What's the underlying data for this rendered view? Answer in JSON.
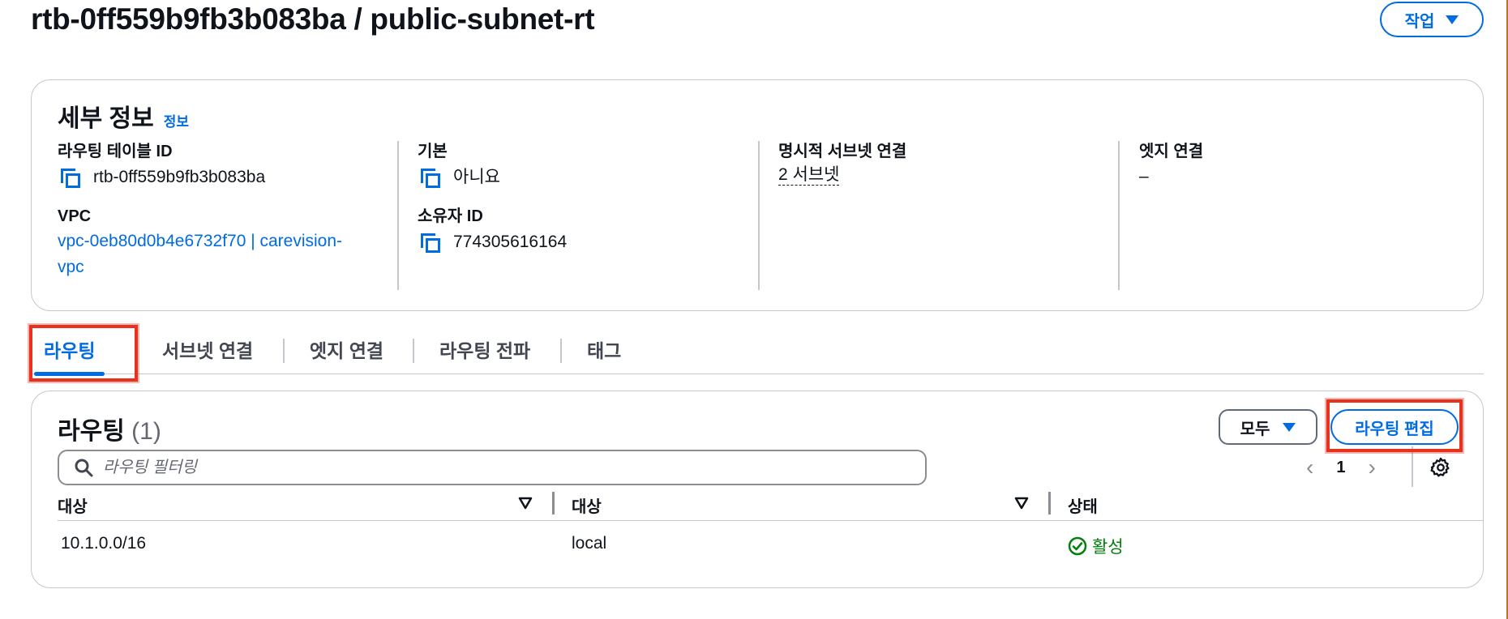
{
  "header": {
    "title": "rtb-0ff559b9fb3b083ba / public-subnet-rt",
    "actions_label": "작업"
  },
  "details": {
    "heading": "세부 정보",
    "info_label": "정보",
    "route_table_id": {
      "label": "라우팅 테이블 ID",
      "value": "rtb-0ff559b9fb3b083ba"
    },
    "vpc": {
      "label": "VPC",
      "line1": "vpc-0eb80d0b4e6732f70 | carevision-",
      "line2": "vpc"
    },
    "main": {
      "label": "기본",
      "value": "아니요"
    },
    "owner_id": {
      "label": "소유자 ID",
      "value": "774305616164"
    },
    "explicit_subnets": {
      "label": "명시적 서브넷 연결",
      "value": "2 서브넷"
    },
    "edge_assoc": {
      "label": "엣지 연결",
      "value": "–"
    }
  },
  "tabs": [
    {
      "label": "라우팅",
      "active": true
    },
    {
      "label": "서브넷 연결",
      "active": false
    },
    {
      "label": "엣지 연결",
      "active": false
    },
    {
      "label": "라우팅 전파",
      "active": false
    },
    {
      "label": "태그",
      "active": false
    }
  ],
  "routes": {
    "title": "라우팅",
    "count": "(1)",
    "filter_select": "모두",
    "edit_label": "라우팅 편집",
    "filter_placeholder": "라우팅 필터링",
    "page": "1",
    "columns": [
      "대상",
      "대상",
      "상태"
    ],
    "rows": [
      {
        "destination": "10.1.0.0/16",
        "target": "local",
        "status": "활성"
      }
    ]
  },
  "colors": {
    "accent": "#006ce0",
    "success": "#037f0c",
    "annotation": "#e8321e"
  }
}
